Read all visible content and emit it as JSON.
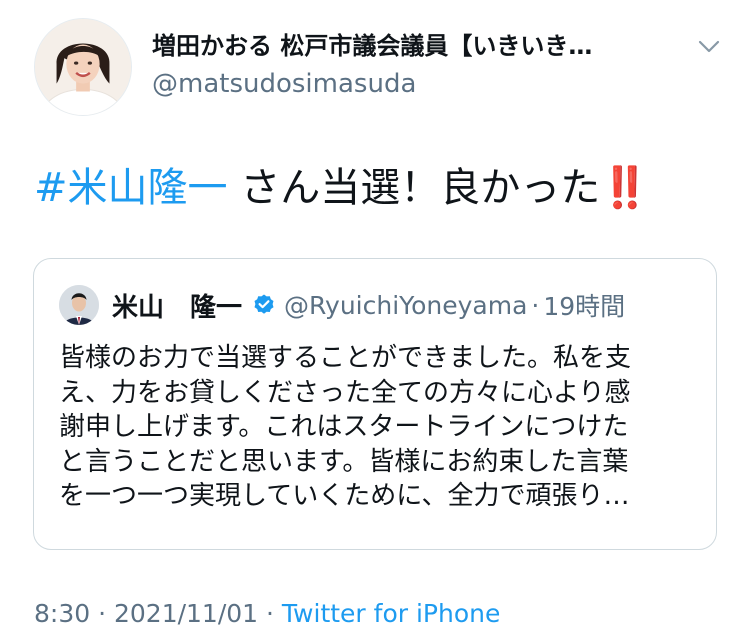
{
  "author": {
    "display_name": "増田かおる 松戸市議会議員【いきいき…",
    "handle": "@matsudosimasuda"
  },
  "icons": {
    "more": "chevron-down-icon",
    "verified": "verified-badge-icon",
    "emphasis": "double-exclamation-icon"
  },
  "tweet": {
    "hashtag": "#米山隆一",
    "text": " さん当選！良かった",
    "emphasis": "‼️"
  },
  "quoted": {
    "name": "米山　隆一",
    "handle": "@RyuichiYoneyama",
    "separator": "·",
    "time": "19時間",
    "lines": [
      "皆様のお力で当選することができました。私を支",
      "え、力をお貸しくださった全ての方々に心より感",
      "謝申し上げます。これはスタートラインにつけた",
      "と言うことだと思います。皆様にお約束した言葉",
      "を一つ一つ実現していくために、全力で頑張り…"
    ]
  },
  "footer": {
    "time": "8:30",
    "separator1": " · ",
    "date": "2021/11/01",
    "separator2": " · ",
    "source": "Twitter for iPhone"
  },
  "colors": {
    "link": "#1d9bf0",
    "muted": "#5b7083",
    "verified": "#1d9bf0",
    "border": "#cfd9de",
    "emphasis": "#e0245e"
  }
}
